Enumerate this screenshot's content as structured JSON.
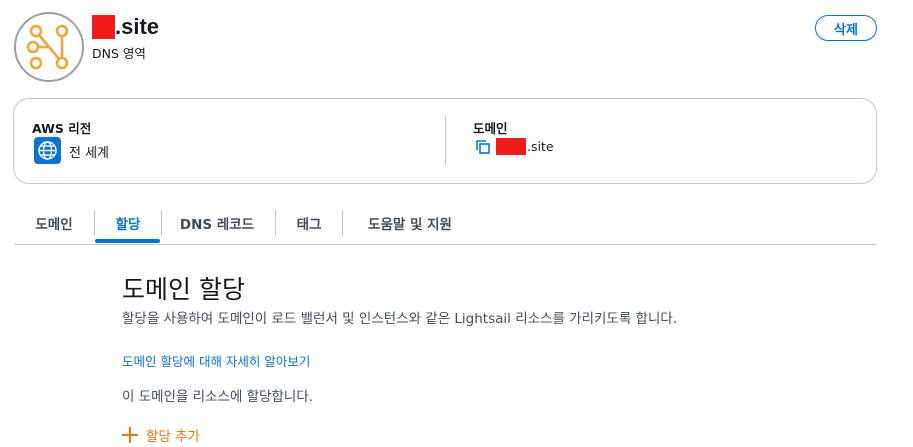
{
  "header": {
    "title_suffix": ".site",
    "subtitle": "DNS 영역",
    "delete_label": "삭제",
    "icon": "lightsail-dns-zone-icon"
  },
  "info_card": {
    "region_label": "AWS 리전",
    "region_value": "전 세계",
    "domain_label": "도메인",
    "domain_suffix": ".site"
  },
  "tabs": [
    {
      "label": "도메인"
    },
    {
      "label": "할당"
    },
    {
      "label": "DNS 레코드"
    },
    {
      "label": "태그"
    },
    {
      "label": "도움말 및 지원"
    }
  ],
  "active_tab": "할당",
  "section": {
    "title": "도메인 할당",
    "description": "할당을 사용하여 도메인이 로드 밸런서 및 인스턴스와 같은 Lightsail 리소스를 가리키도록 합니다.",
    "learn_more": "도메인 할당에 대해 자세히 알아보기",
    "note": "이 도메인을 리소스에 할당합니다.",
    "add_label": "할당 추가"
  },
  "colors": {
    "accent": "#0972d3",
    "orange": "#ec7211",
    "redaction": "#f01c1c"
  }
}
